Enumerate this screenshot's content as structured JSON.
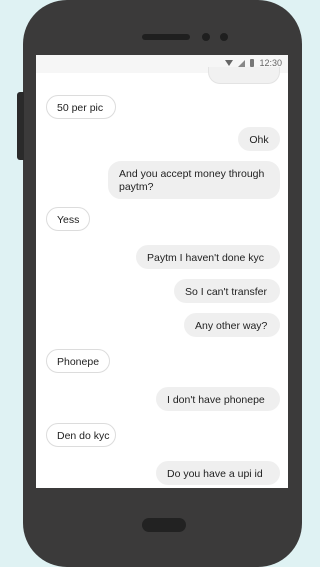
{
  "status": {
    "time": "12:30"
  },
  "messages": [
    {
      "dir": "recv",
      "text": "50 per pic"
    },
    {
      "dir": "sent",
      "text": "Ohk"
    },
    {
      "dir": "sent",
      "text": "And you accept money through\npaytm?"
    },
    {
      "dir": "recv",
      "text": "Yess"
    },
    {
      "dir": "sent",
      "text": "Paytm I haven't done kyc"
    },
    {
      "dir": "sent",
      "text": "So I can't transfer"
    },
    {
      "dir": "sent",
      "text": "Any other way?"
    },
    {
      "dir": "recv",
      "text": "Phonepe"
    },
    {
      "dir": "sent",
      "text": "I don't have phonepe"
    },
    {
      "dir": "recv",
      "text": "Den do kyc"
    },
    {
      "dir": "sent",
      "text": "Do you have a upi id"
    }
  ]
}
